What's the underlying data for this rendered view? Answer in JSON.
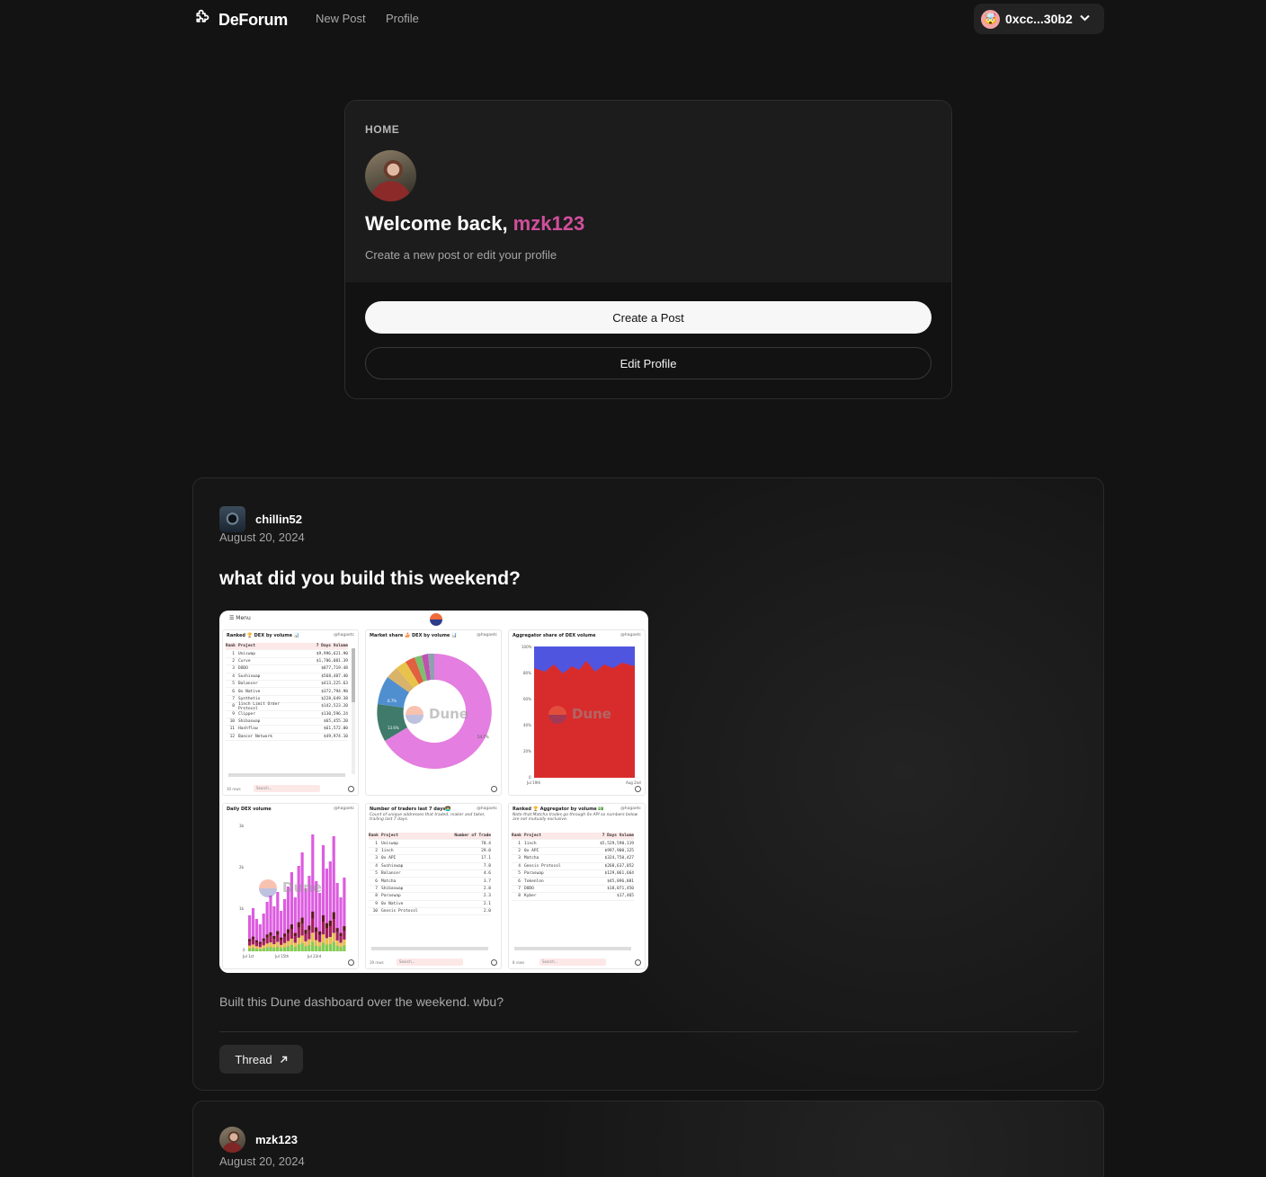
{
  "header": {
    "brand": "DeForum",
    "nav": [
      {
        "label": "New Post"
      },
      {
        "label": "Profile"
      }
    ],
    "wallet": {
      "address": "0xcc...30b2",
      "avatar_emoji": "🤯"
    }
  },
  "welcome": {
    "section_label": "HOME",
    "greeting": "Welcome back, ",
    "username": "mzk123",
    "subtitle": "Create a new post or edit your profile",
    "primary_button": "Create a Post",
    "secondary_button": "Edit Profile"
  },
  "posts": [
    {
      "author": "chillin52",
      "date": "August 20, 2024",
      "title": "what did you build this weekend?",
      "body": "Built this Dune dashboard over the weekend. wbu?",
      "thread_label": "Thread",
      "image": {
        "menu": "Menu",
        "watermark": "Dune",
        "handle": "@hagaetc",
        "panels": {
          "ranked_title": "Ranked 🏆 DEX by volume 📊",
          "market_share_title": "Market share 🍰 DEX by volume 📊",
          "aggregator_share_title": "Aggregator share of DEX volume",
          "daily_title": "Daily DEX volume",
          "traders_title": "Number of traders last 7 days👨‍💻",
          "traders_note": "Count of unique addresses that traded, maker and taker, trailing last 7 days.",
          "ranked_agg_title": "Ranked 🏆 Aggregator by volume 💵",
          "ranked_agg_note": "Note that Matcha trades go through 0x API so numbers below are not mutually exclusive.",
          "ranked_rows_label": "30 rows",
          "traders_rows_label": "39 rows",
          "agg_rows_label": "8 rows",
          "search_placeholder": "Search...",
          "col_rank": "Rank",
          "col_project": "Project",
          "col_volume": "7 Days Volume",
          "col_traders": "Number of Trade",
          "ranked_rows": [
            {
              "rank": "1",
              "project": "Uniswap",
              "value": "$9,996,621.90"
            },
            {
              "rank": "2",
              "project": "Curve",
              "value": "$1,786,081.39"
            },
            {
              "rank": "3",
              "project": "DODO",
              "value": "$877,719.48"
            },
            {
              "rank": "4",
              "project": "Sushiswap",
              "value": "$568,487.40"
            },
            {
              "rank": "5",
              "project": "Balancer",
              "value": "$413,225.63"
            },
            {
              "rank": "6",
              "project": "0x Native",
              "value": "$372,794.90"
            },
            {
              "rank": "7",
              "project": "Synthetix",
              "value": "$228,649.38"
            },
            {
              "rank": "8",
              "project": "1inch Limit Order Protocol",
              "value": "$142,523.20"
            },
            {
              "rank": "9",
              "project": "Clipper",
              "value": "$130,596.24"
            },
            {
              "rank": "10",
              "project": "Shibaswap",
              "value": "$65,455.20"
            },
            {
              "rank": "11",
              "project": "Hashflow",
              "value": "$61,572.00"
            },
            {
              "rank": "12",
              "project": "Bancor Network",
              "value": "$49,974.10"
            }
          ],
          "trader_rows": [
            {
              "rank": "1",
              "project": "Uniswap",
              "value": "78.4"
            },
            {
              "rank": "2",
              "project": "1inch",
              "value": "29.0"
            },
            {
              "rank": "3",
              "project": "0x API",
              "value": "17.1"
            },
            {
              "rank": "4",
              "project": "Sushiswap",
              "value": "7.8"
            },
            {
              "rank": "5",
              "project": "Balancer",
              "value": "4.6"
            },
            {
              "rank": "6",
              "project": "Matcha",
              "value": "3.7"
            },
            {
              "rank": "7",
              "project": "Shibaswap",
              "value": "2.8"
            },
            {
              "rank": "8",
              "project": "Paraswap",
              "value": "2.3"
            },
            {
              "rank": "9",
              "project": "0x Native",
              "value": "2.1"
            },
            {
              "rank": "10",
              "project": "Gnosis Protocol",
              "value": "2.0"
            }
          ],
          "agg_rows": [
            {
              "rank": "1",
              "project": "1inch",
              "value": "$5,529,590,119"
            },
            {
              "rank": "2",
              "project": "0x API",
              "value": "$997,900,125"
            },
            {
              "rank": "3",
              "project": "Matcha",
              "value": "$324,750,427"
            },
            {
              "rank": "4",
              "project": "Gnosis Protocol",
              "value": "$268,637,052"
            },
            {
              "rank": "5",
              "project": "Paraswap",
              "value": "$129,061,664"
            },
            {
              "rank": "6",
              "project": "Tokenlon",
              "value": "$45,096,881"
            },
            {
              "rank": "7",
              "project": "DODO",
              "value": "$18,071,450"
            },
            {
              "rank": "8",
              "project": "Kyber",
              "value": "$17,465"
            }
          ],
          "pie_labels": [
            "54.7%",
            "13.6%",
            "6.7%"
          ],
          "agg_axis": [
            "100%",
            "80%",
            "60%",
            "40%",
            "20%",
            "0"
          ],
          "agg_x": [
            "Jul 19th",
            "Aug 2nd"
          ],
          "daily_axis": [
            "3b",
            "2b",
            "1b",
            "0"
          ],
          "daily_x": [
            "Jul 1st",
            "Jul 15th",
            "Jul 23rd"
          ]
        }
      }
    },
    {
      "author": "mzk123",
      "date": "August 20, 2024"
    }
  ],
  "colors": {
    "background": "#131313",
    "accent_username": "#d04f9c",
    "card": "#1c1c1c"
  }
}
